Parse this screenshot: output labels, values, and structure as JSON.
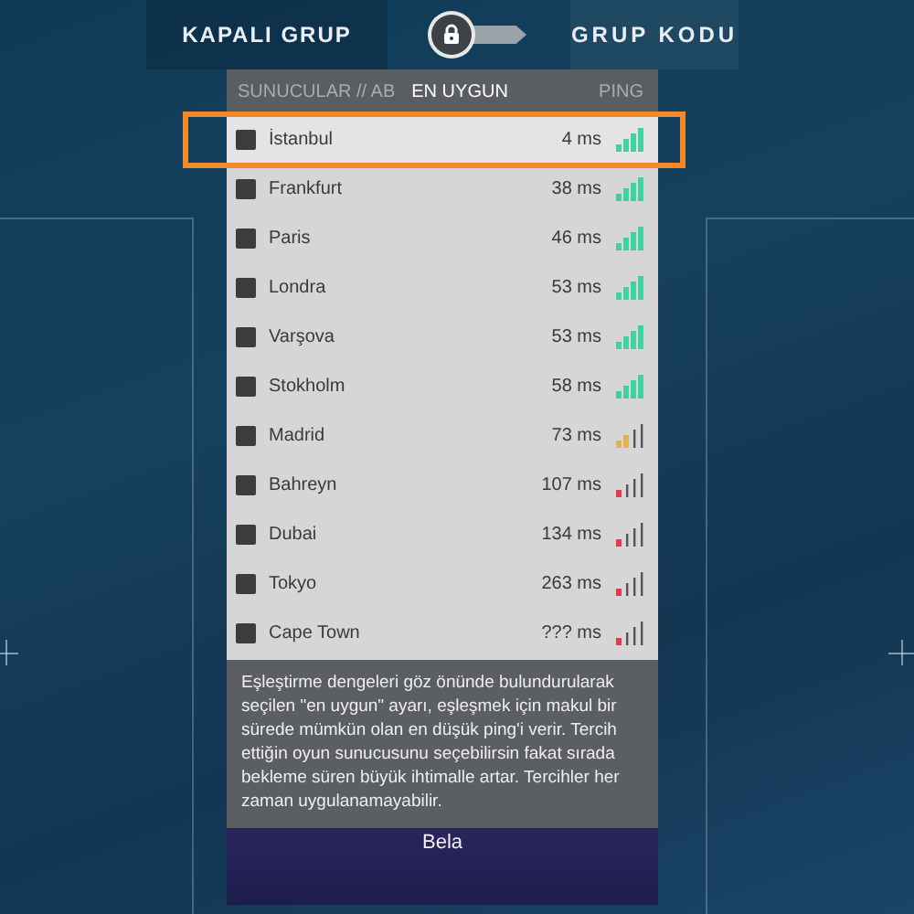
{
  "top_bar": {
    "left_tab": "KAPALI GRUP",
    "toggle": {
      "on": false
    },
    "right_tab": "GRUP KODU"
  },
  "server_panel": {
    "title": "SUNUCULAR // AB",
    "sort_options": [
      {
        "label": "EN UYGUN",
        "selected": true
      },
      {
        "label": "PING",
        "selected": false
      }
    ],
    "servers": [
      {
        "name": "İstanbul",
        "ping": "4 ms",
        "color": "#3fd3a0",
        "checked": false,
        "selected": true
      },
      {
        "name": "Frankfurt",
        "ping": "38 ms",
        "color": "#3fd3a0",
        "checked": false,
        "selected": false
      },
      {
        "name": "Paris",
        "ping": "46 ms",
        "color": "#3fd3a0",
        "checked": false,
        "selected": false
      },
      {
        "name": "Londra",
        "ping": "53 ms",
        "color": "#3fd3a0",
        "checked": false,
        "selected": false
      },
      {
        "name": "Varşova",
        "ping": "53 ms",
        "color": "#3fd3a0",
        "checked": false,
        "selected": false
      },
      {
        "name": "Stokholm",
        "ping": "58 ms",
        "color": "#3fd3a0",
        "checked": false,
        "selected": false
      },
      {
        "name": "Madrid",
        "ping": "73 ms",
        "color": "#e2b24c",
        "checked": false,
        "selected": false
      },
      {
        "name": "Bahreyn",
        "ping": "107 ms",
        "color": "#e23c4c",
        "checked": false,
        "selected": false
      },
      {
        "name": "Dubai",
        "ping": "134 ms",
        "color": "#e23c4c",
        "checked": false,
        "selected": false
      },
      {
        "name": "Tokyo",
        "ping": "263 ms",
        "color": "#e23c4c",
        "checked": false,
        "selected": false
      },
      {
        "name": "Cape Town",
        "ping": "??? ms",
        "color": "#e23c4c",
        "checked": false,
        "selected": false
      }
    ],
    "tooltip": "Eşleştirme dengeleri göz önünde bulundurularak seçilen \"en uygun\" ayarı, eşleşmek için makul bir sürede mümkün olan en düşük ping'i verir. Tercih ettiğin oyun sunucusunu seçebilirsin fakat sırada bekleme süren büyük ihtimalle artar. Tercihler her zaman uygulanamayabilir."
  },
  "player_card": {
    "name": "Bela"
  }
}
